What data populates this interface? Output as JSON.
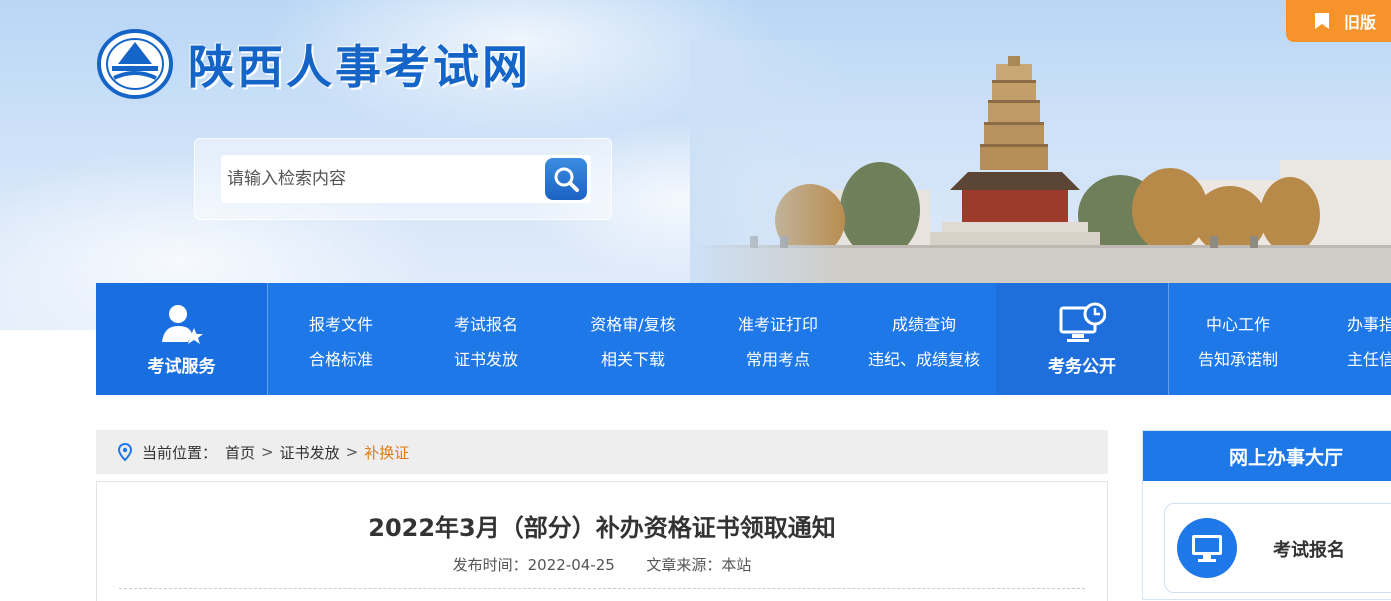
{
  "header": {
    "site_title": "陕西人事考试网",
    "old_version_label": "旧版",
    "search": {
      "placeholder": "请输入检索内容"
    }
  },
  "nav": {
    "service_label": "考试服务",
    "service_links": [
      {
        "label": "报考文件"
      },
      {
        "label": "考试报名"
      },
      {
        "label": "资格审/复核"
      },
      {
        "label": "准考证打印"
      },
      {
        "label": "成绩查询"
      },
      {
        "label": "合格标准"
      },
      {
        "label": "证书发放"
      },
      {
        "label": "相关下载"
      },
      {
        "label": "常用考点"
      },
      {
        "label": "违纪、成绩复核"
      }
    ],
    "affairs_label": "考务公开",
    "affairs_links": [
      {
        "label": "中心工作"
      },
      {
        "label": "办事指"
      },
      {
        "label": "告知承诺制"
      },
      {
        "label": "主任信"
      }
    ]
  },
  "breadcrumb": {
    "prefix": "当前位置：",
    "items": [
      "首页",
      "证书发放"
    ],
    "current": "补换证",
    "separator": ">"
  },
  "article": {
    "title": "2022年3月（部分）补办资格证书领取通知",
    "publish_label": "发布时间：",
    "publish_date": "2022-04-25",
    "source_label": "文章来源：",
    "source": "本站"
  },
  "side_panel": {
    "title": "网上办事大厅",
    "cards": [
      {
        "label": "考试报名",
        "icon": "monitor-icon"
      }
    ]
  },
  "colors": {
    "primary_blue": "#1f78e8",
    "accent_orange": "#f7932b",
    "breadcrumb_current": "#e07a10"
  }
}
